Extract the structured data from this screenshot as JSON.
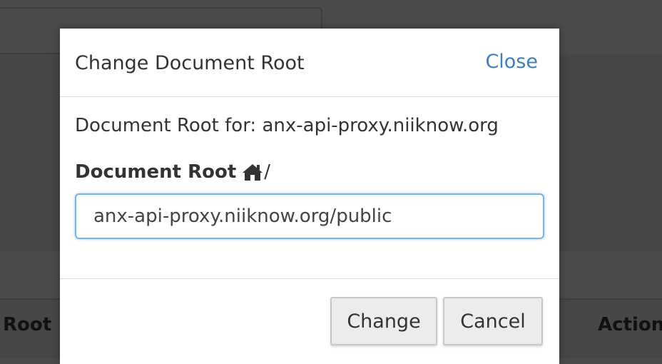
{
  "background": {
    "columns": {
      "root_label": "Root",
      "actions_label": "Action"
    }
  },
  "modal": {
    "title": "Change Document Root",
    "close_label": "Close",
    "for_line": "Document Root for: anx-api-proxy.niiknow.org",
    "field_label": "Document Root",
    "field_suffix": "/",
    "home_icon": "home-icon",
    "input_value": "anx-api-proxy.niiknow.org/public",
    "change_label": "Change",
    "cancel_label": "Cancel",
    "colors": {
      "link": "#3a7fc0",
      "input_focus_border": "#79b2e6"
    }
  }
}
